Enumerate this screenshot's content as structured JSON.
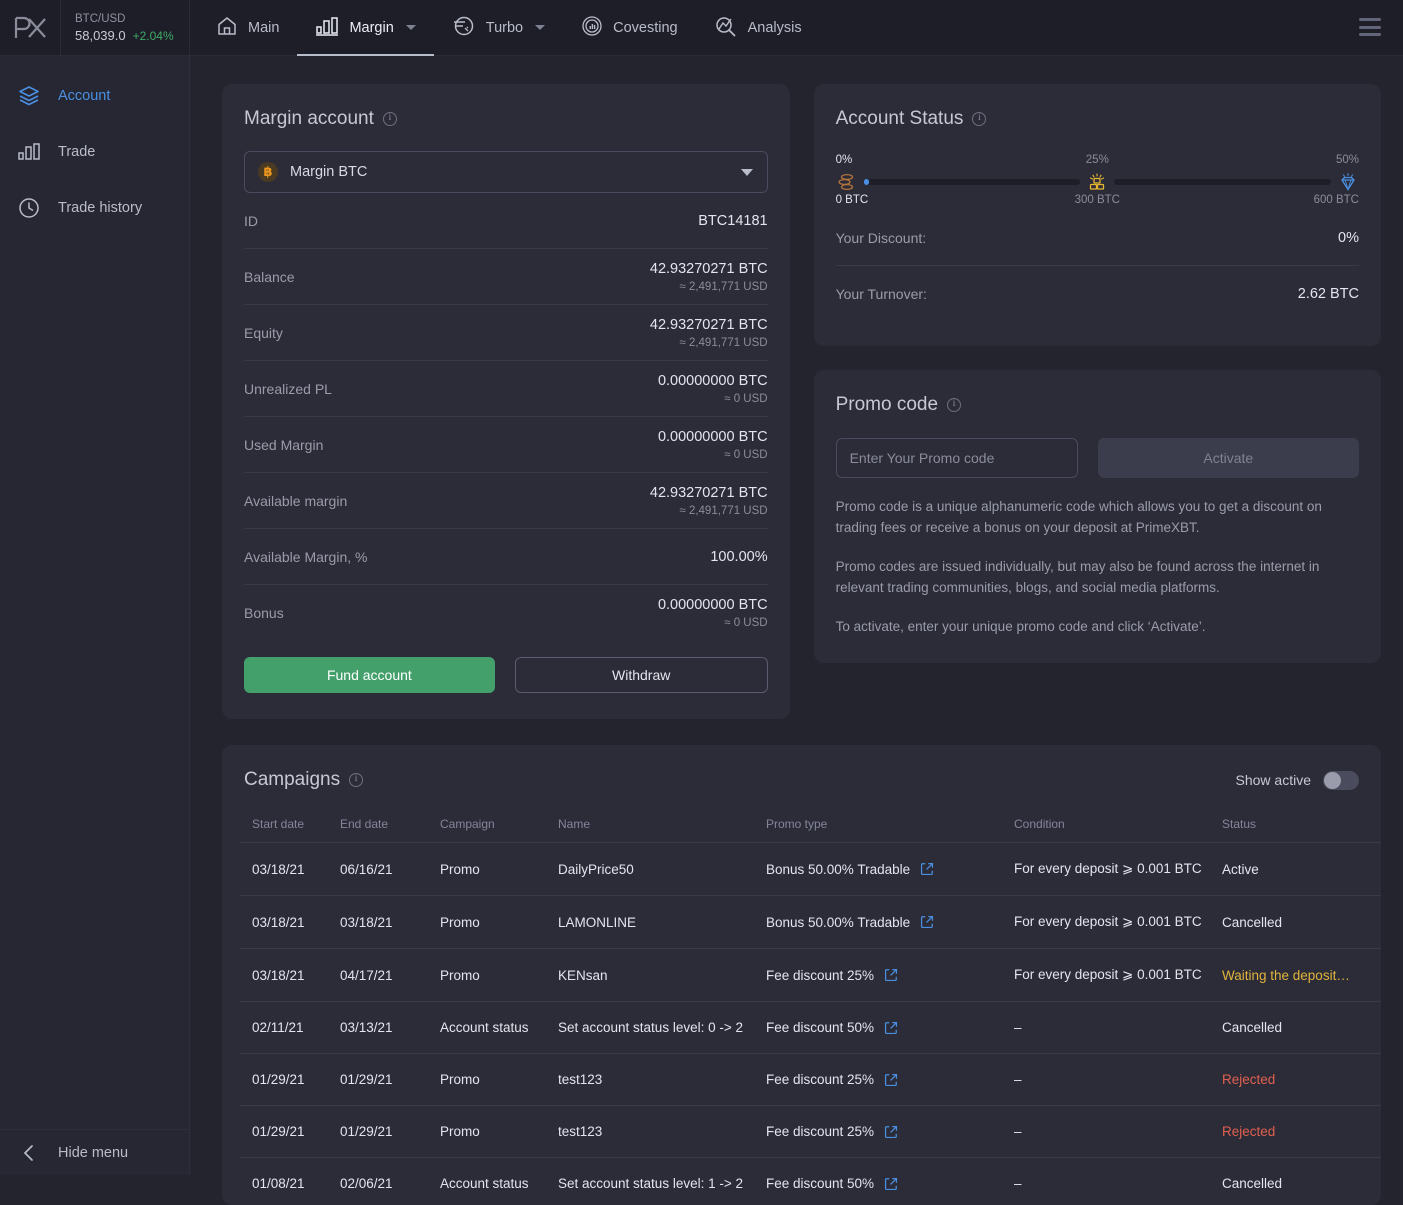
{
  "topbar": {
    "logo_name": "primexbt-logo",
    "ticker": {
      "pair": "BTC/USD",
      "price": "58,039.0",
      "change": "+2.04%",
      "change_color": "#3fa968"
    },
    "nav": [
      {
        "label": "Main",
        "icon": "home-icon",
        "active": false,
        "has_caret": false
      },
      {
        "label": "Margin",
        "icon": "bar-chart-icon",
        "active": true,
        "has_caret": true
      },
      {
        "label": "Turbo",
        "icon": "turbo-icon",
        "active": false,
        "has_caret": true
      },
      {
        "label": "Covesting",
        "icon": "covesting-icon",
        "active": false,
        "has_caret": false
      },
      {
        "label": "Analysis",
        "icon": "analysis-icon",
        "active": false,
        "has_caret": false
      }
    ],
    "menu_icon": "hamburger-menu-icon"
  },
  "sidebar": {
    "items": [
      {
        "label": "Account",
        "icon": "layers-icon",
        "active": true
      },
      {
        "label": "Trade",
        "icon": "bar-chart-icon",
        "active": false
      },
      {
        "label": "Trade history",
        "icon": "clock-icon",
        "active": false
      }
    ],
    "hide_menu": {
      "label": "Hide menu",
      "icon": "chevron-left-icon"
    }
  },
  "margin_account": {
    "title": "Margin account",
    "selected_account": "Margin BTC",
    "coin_symbol": "฿",
    "rows": [
      {
        "key": "ID",
        "value": "BTC14181",
        "sub": ""
      },
      {
        "key": "Balance",
        "value": "42.93270271 BTC",
        "sub": "≈ 2,491,771 USD"
      },
      {
        "key": "Equity",
        "value": "42.93270271 BTC",
        "sub": "≈ 2,491,771 USD"
      },
      {
        "key": "Unrealized PL",
        "value": "0.00000000 BTC",
        "sub": "≈ 0 USD"
      },
      {
        "key": "Used Margin",
        "value": "0.00000000 BTC",
        "sub": "≈ 0 USD"
      },
      {
        "key": "Available margin",
        "value": "42.93270271 BTC",
        "sub": "≈ 2,491,771 USD"
      },
      {
        "key": "Available Margin, %",
        "value": "100.00%",
        "sub": ""
      },
      {
        "key": "Bonus",
        "value": "0.00000000 BTC",
        "sub": "≈ 0 USD"
      }
    ],
    "fund_label": "Fund account",
    "withdraw_label": "Withdraw",
    "fund_color": "#44a06b"
  },
  "account_status": {
    "title": "Account Status",
    "progress": {
      "pct_start": "0%",
      "pct_mid": "25%",
      "pct_end": "50%",
      "btc_start": "0 BTC",
      "btc_mid": "300 BTC",
      "btc_end": "600 BTC",
      "fill_percent": 1,
      "icon_start": "copper-coins-icon",
      "icon_mid": "gold-bars-icon",
      "icon_end": "diamond-icon"
    },
    "rows": [
      {
        "key": "Your Discount:",
        "value": "0%"
      },
      {
        "key": "Your Turnover:",
        "value": "2.62 BTC"
      }
    ]
  },
  "promo_code": {
    "title": "Promo code",
    "input_placeholder": "Enter Your Promo code",
    "input_value": "",
    "activate_label": "Activate",
    "paragraphs": [
      "Promo code is a unique alphanumeric code which allows you to get a discount on trading fees or receive a bonus on your deposit at PrimeXBT.",
      "Promo codes are issued individually, but may also be found across the internet in relevant trading communities, blogs, and social media platforms.",
      "To activate, enter your unique promo code and click ‘Activate’."
    ]
  },
  "campaigns": {
    "title": "Campaigns",
    "show_active_label": "Show active",
    "show_active_on": false,
    "columns": [
      "Start date",
      "End date",
      "Campaign",
      "Name",
      "Promo type",
      "Condition",
      "Status"
    ],
    "rows": [
      {
        "start": "03/18/21",
        "end": "06/16/21",
        "campaign": "Promo",
        "name": "DailyPrice50",
        "promo_type": "Bonus 50.00% Tradable",
        "condition": "For every deposit ⩾ 0.001 BTC",
        "status": "Active",
        "status_style": "st-active"
      },
      {
        "start": "03/18/21",
        "end": "03/18/21",
        "campaign": "Promo",
        "name": "LAMONLINE",
        "promo_type": "Bonus 50.00% Tradable",
        "condition": "For every deposit ⩾ 0.001 BTC",
        "status": "Cancelled",
        "status_style": "st-cancelled"
      },
      {
        "start": "03/18/21",
        "end": "04/17/21",
        "campaign": "Promo",
        "name": "KENsan",
        "promo_type": "Fee discount 25%",
        "condition": "For every deposit ⩾ 0.001 BTC",
        "status": "Waiting the deposit…",
        "status_style": "st-waiting"
      },
      {
        "start": "02/11/21",
        "end": "03/13/21",
        "campaign": "Account status",
        "name": "Set account status level: 0 -> 2",
        "promo_type": "Fee discount 50%",
        "condition": "–",
        "status": "Cancelled",
        "status_style": "st-cancelled"
      },
      {
        "start": "01/29/21",
        "end": "01/29/21",
        "campaign": "Promo",
        "name": "test123",
        "promo_type": "Fee discount 25%",
        "condition": "–",
        "status": "Rejected",
        "status_style": "st-rejected"
      },
      {
        "start": "01/29/21",
        "end": "01/29/21",
        "campaign": "Promo",
        "name": "test123",
        "promo_type": "Fee discount 25%",
        "condition": "–",
        "status": "Rejected",
        "status_style": "st-rejected"
      },
      {
        "start": "01/08/21",
        "end": "02/06/21",
        "campaign": "Account status",
        "name": "Set account status level: 1 -> 2",
        "promo_type": "Fee discount 50%",
        "condition": "–",
        "status": "Cancelled",
        "status_style": "st-cancelled"
      }
    ],
    "external_link_icon": "external-link-icon"
  }
}
